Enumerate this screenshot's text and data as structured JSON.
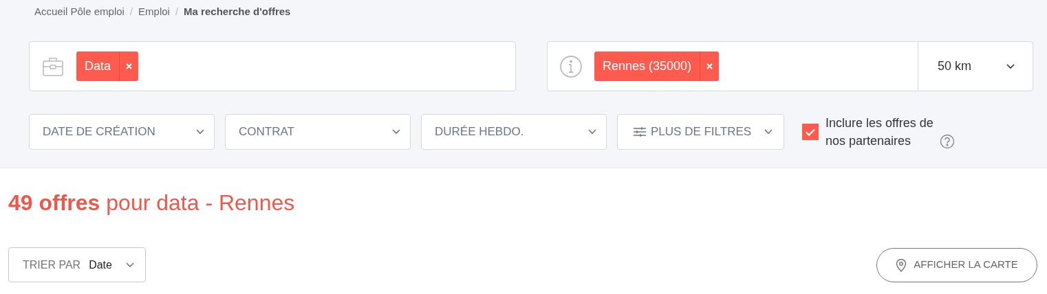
{
  "breadcrumb_separator": "/",
  "breadcrumb": [
    {
      "label": "Accueil Pôle emploi",
      "current": false
    },
    {
      "label": "Emploi",
      "current": false
    },
    {
      "label": "Ma recherche d'offres",
      "current": true
    }
  ],
  "keyword_search": {
    "tags": [
      "Data"
    ]
  },
  "location_search": {
    "tags": [
      "Rennes (35000)"
    ],
    "distance": "50 km"
  },
  "filters": [
    {
      "label": "DATE DE CRÉATION",
      "kind": "select"
    },
    {
      "label": "CONTRAT",
      "kind": "select"
    },
    {
      "label": "DURÉE HEBDO.",
      "kind": "select"
    },
    {
      "label": "PLUS DE FILTRES",
      "kind": "more"
    }
  ],
  "partners": {
    "label": "Inclure les offres de nos partenaires",
    "checked": true
  },
  "results_title": "**49 offres** pour data - Rennes",
  "sort": {
    "label": "TRIER PAR",
    "value": "Date"
  },
  "map_button": "AFFICHER LA CARTE"
}
